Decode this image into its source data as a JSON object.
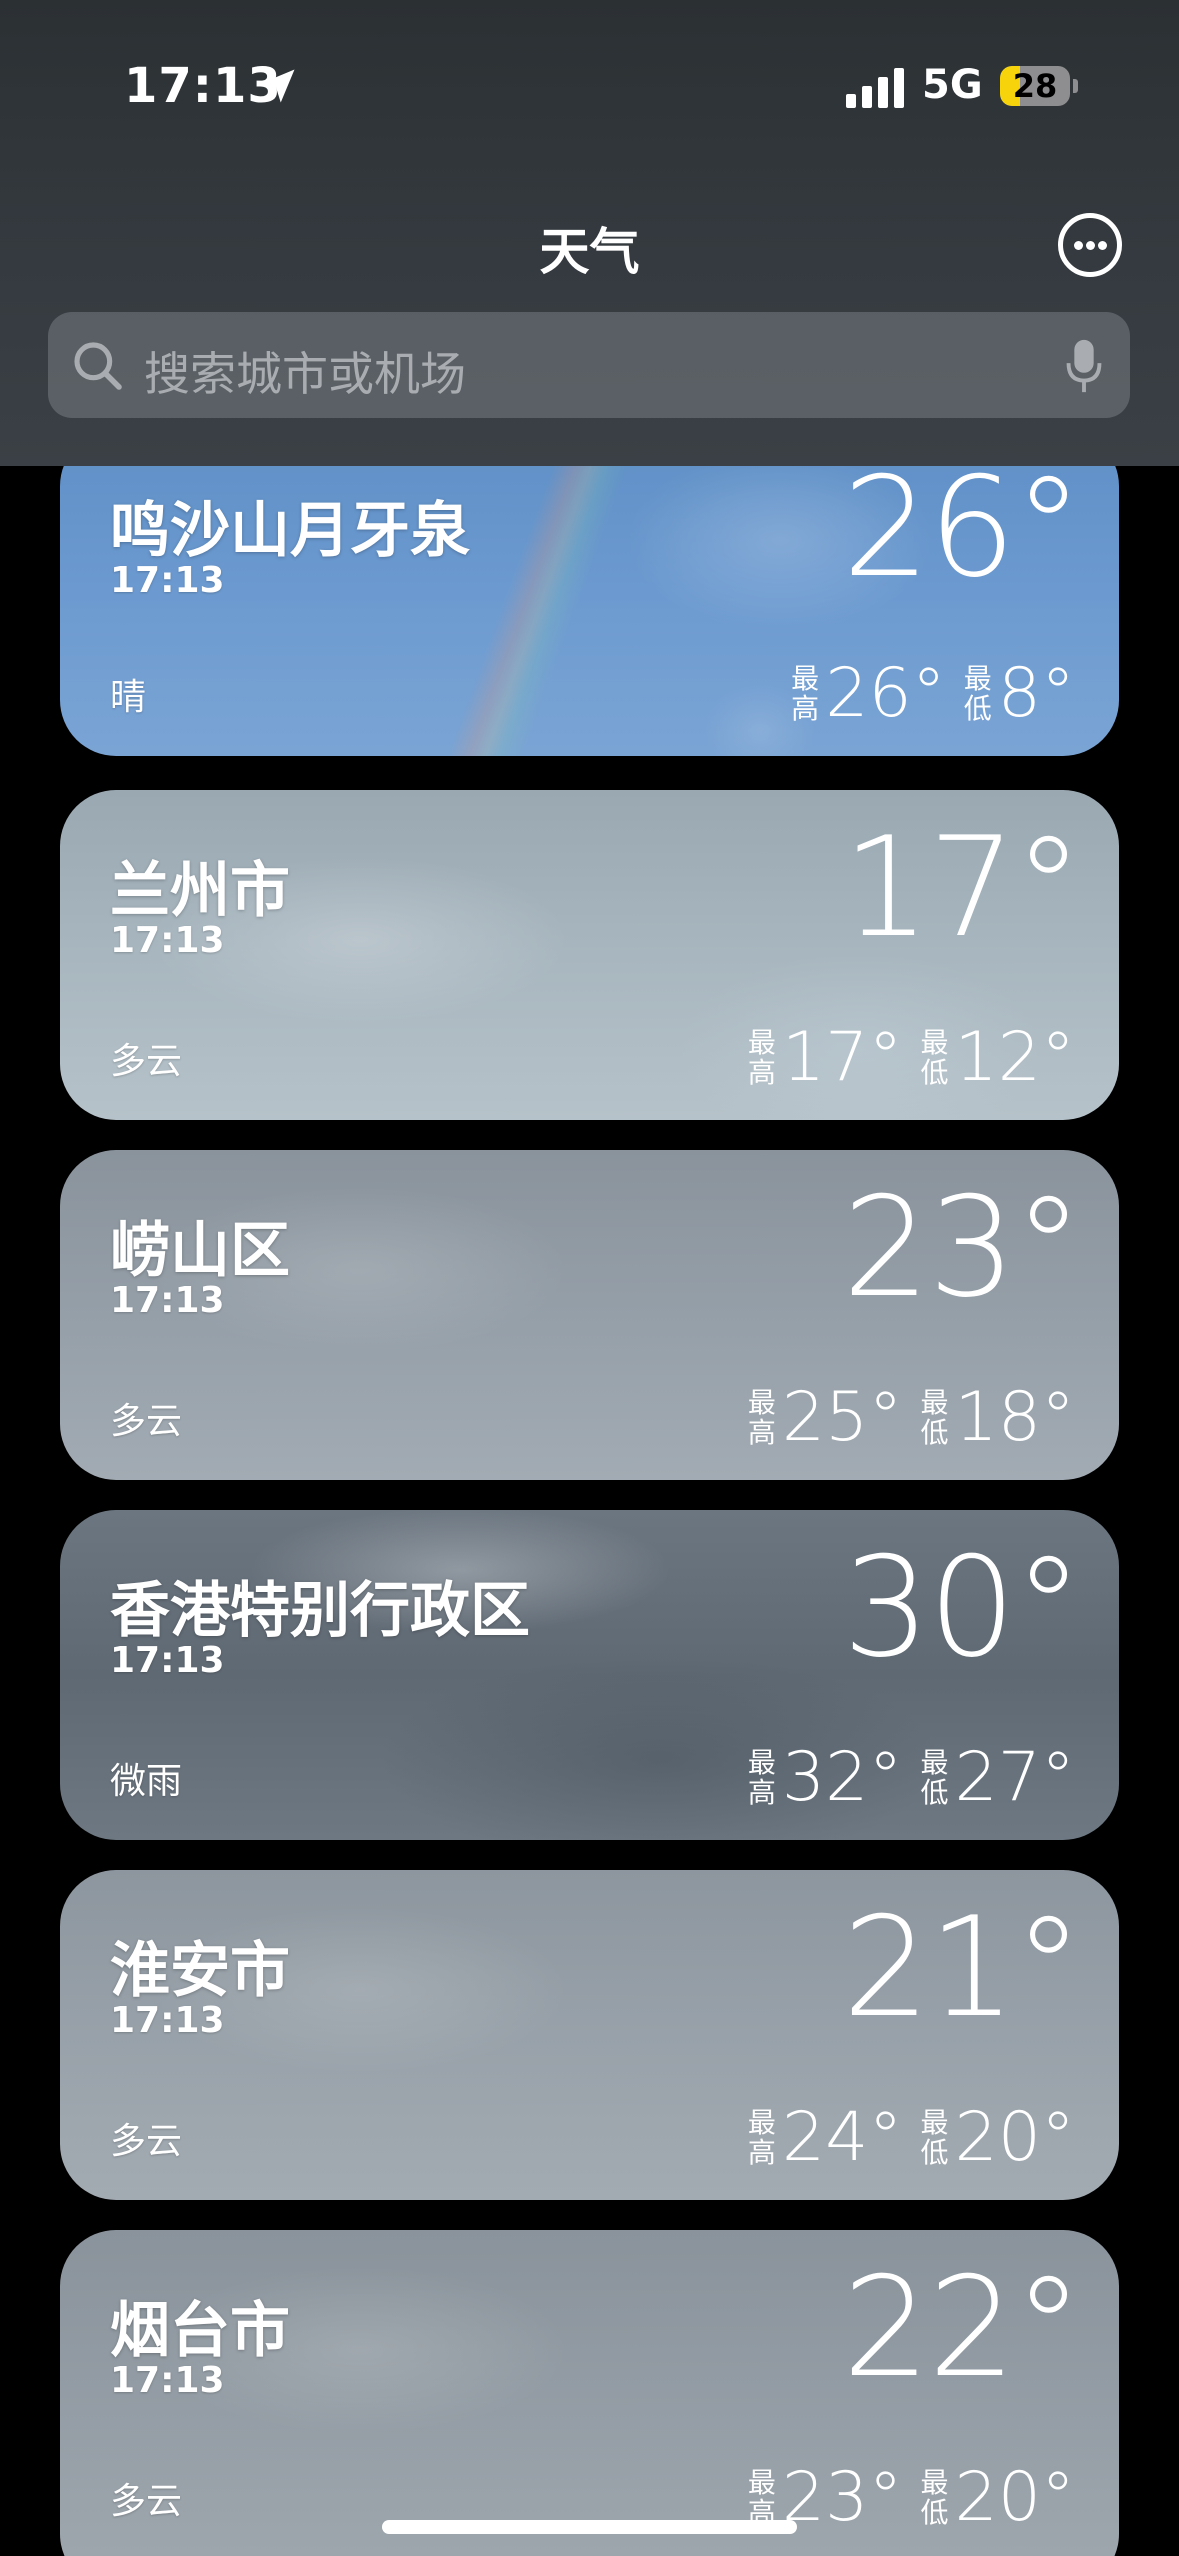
{
  "status_bar": {
    "time": "17:13",
    "network": "5G",
    "battery": "28",
    "battery_level": 0.28
  },
  "header": {
    "title": "天气",
    "search_placeholder": "搜索城市或机场"
  },
  "cities": [
    {
      "name": "鸣沙山月牙泉",
      "time": "17:13",
      "condition": "晴",
      "temp": "26°",
      "high_label": [
        "最",
        "高"
      ],
      "high": "26°",
      "low_label": [
        "最",
        "低"
      ],
      "low": "8°"
    },
    {
      "name": "兰州市",
      "time": "17:13",
      "condition": "多云",
      "temp": "17°",
      "high_label": [
        "最",
        "高"
      ],
      "high": "17°",
      "low_label": [
        "最",
        "低"
      ],
      "low": "12°"
    },
    {
      "name": "崂山区",
      "time": "17:13",
      "condition": "多云",
      "temp": "23°",
      "high_label": [
        "最",
        "高"
      ],
      "high": "25°",
      "low_label": [
        "最",
        "低"
      ],
      "low": "18°"
    },
    {
      "name": "香港特别行政区",
      "time": "17:13",
      "condition": "微雨",
      "temp": "30°",
      "high_label": [
        "最",
        "高"
      ],
      "high": "32°",
      "low_label": [
        "最",
        "低"
      ],
      "low": "27°"
    },
    {
      "name": "淮安市",
      "time": "17:13",
      "condition": "多云",
      "temp": "21°",
      "high_label": [
        "最",
        "高"
      ],
      "high": "24°",
      "low_label": [
        "最",
        "低"
      ],
      "low": "20°"
    },
    {
      "name": "烟台市",
      "time": "17:13",
      "condition": "多云",
      "temp": "22°",
      "high_label": [
        "最",
        "高"
      ],
      "high": "23°",
      "low_label": [
        "最",
        "低"
      ],
      "low": "20°"
    }
  ],
  "icons": {
    "location": "location-arrow-icon",
    "signal": "cellular-signal-icon",
    "more": "ellipsis-circle-icon",
    "search": "magnifier-icon",
    "mic": "microphone-icon"
  }
}
